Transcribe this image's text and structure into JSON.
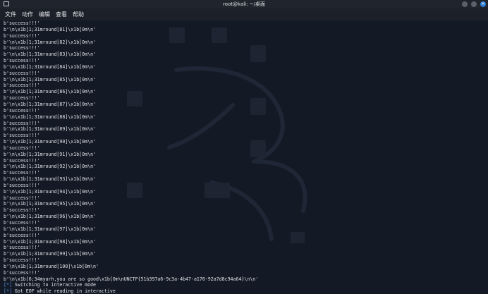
{
  "window": {
    "title": "root@kali: ~/桌面"
  },
  "menu": {
    "items": [
      "文件",
      "动作",
      "编辑",
      "查看",
      "帮助"
    ]
  },
  "terminal": {
    "lines": [
      "b'success!!!'",
      "b'\\n\\x1b[1;31mround[81]\\x1b[0m\\n'",
      "b'success!!!'",
      "b'\\n\\x1b[1;31mround[82]\\x1b[0m\\n'",
      "b'success!!!'",
      "b'\\n\\x1b[1;31mround[83]\\x1b[0m\\n'",
      "b'success!!!'",
      "b'\\n\\x1b[1;31mround[84]\\x1b[0m\\n'",
      "b'success!!!'",
      "b'\\n\\x1b[1;31mround[85]\\x1b[0m\\n'",
      "b'success!!!'",
      "b'\\n\\x1b[1;31mround[86]\\x1b[0m\\n'",
      "b'success!!!'",
      "b'\\n\\x1b[1;31mround[87]\\x1b[0m\\n'",
      "b'success!!!'",
      "b'\\n\\x1b[1;31mround[88]\\x1b[0m\\n'",
      "b'success!!!'",
      "b'\\n\\x1b[1;31mround[89]\\x1b[0m\\n'",
      "b'success!!!'",
      "b'\\n\\x1b[1;31mround[90]\\x1b[0m\\n'",
      "b'success!!!'",
      "b'\\n\\x1b[1;31mround[91]\\x1b[0m\\n'",
      "b'success!!!'",
      "b'\\n\\x1b[1;31mround[92]\\x1b[0m\\n'",
      "b'success!!!'",
      "b'\\n\\x1b[1;31mround[93]\\x1b[0m\\n'",
      "b'success!!!'",
      "b'\\n\\x1b[1;31mround[94]\\x1b[0m\\n'",
      "b'success!!!'",
      "b'\\n\\x1b[1;31mround[95]\\x1b[0m\\n'",
      "b'success!!!'",
      "b'\\n\\x1b[1;31mround[96]\\x1b[0m\\n'",
      "b'success!!!'",
      "b'\\n\\x1b[1;31mround[97]\\x1b[0m\\n'",
      "b'success!!!'",
      "b'\\n\\x1b[1;31mround[98]\\x1b[0m\\n'",
      "b'success!!!'",
      "b'\\n\\x1b[1;31mround[99]\\x1b[0m\\n'",
      "b'success!!!'",
      "b'\\n\\x1b[1;31mround[100]\\x1b[0m\\n'",
      "b'success!!!'",
      "b'\\n\\x1b[6;34myarh,you are so good\\x1b[0m\\nUNCTF{51b397a6-9c3a-4b47-a170-92a7d8c94a64}\\n\\n'"
    ],
    "status_lines": [
      {
        "marker": "[*]",
        "text": " Switching to interactive mode"
      },
      {
        "marker": "[*]",
        "text": " Got EOF while reading in interactive"
      }
    ]
  },
  "colors": {
    "background": "#141a25",
    "text": "#dfe2e8",
    "status_marker": "#4f8fe6",
    "close_button": "#2f7fd6"
  },
  "icons": [
    "terminal-icon",
    "minimize-icon",
    "maximize-icon",
    "close-icon"
  ]
}
